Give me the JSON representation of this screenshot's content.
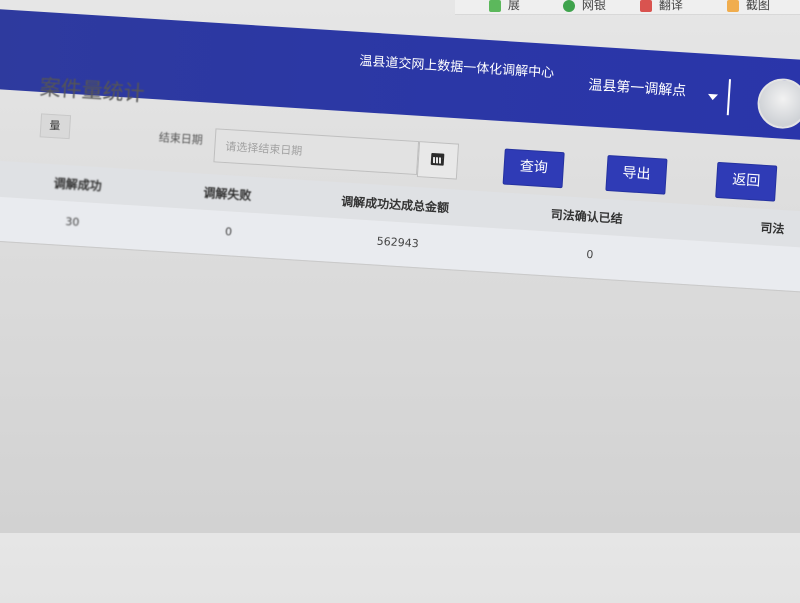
{
  "browser_toolbar": {
    "items": [
      {
        "label": "展",
        "icon": "green-icon"
      },
      {
        "label": "网银",
        "icon": "plus-circle-icon"
      },
      {
        "label": "翻译",
        "icon": "translate-icon"
      },
      {
        "label": "截图",
        "icon": "scissors-icon"
      }
    ]
  },
  "header": {
    "system_title": "温县道交网上数据一体化调解中心",
    "user_name": "温县第一调解点"
  },
  "page": {
    "title": "案件量统计"
  },
  "filters": {
    "small_button_label": "量",
    "end_date_label": "结束日期",
    "end_date_placeholder": "请选择结束日期",
    "end_date_value": ""
  },
  "actions": {
    "query": "查询",
    "export": "导出",
    "back": "返回"
  },
  "table": {
    "columns": [
      "调解成功",
      "调解失败",
      "调解成功达成总金额",
      "司法确认已结",
      "司法"
    ],
    "rows": [
      [
        "30",
        "0",
        "562943",
        "0",
        ""
      ]
    ]
  },
  "colors": {
    "header_bg": "#2e3a9e",
    "button_bg": "#2f3bb6"
  }
}
